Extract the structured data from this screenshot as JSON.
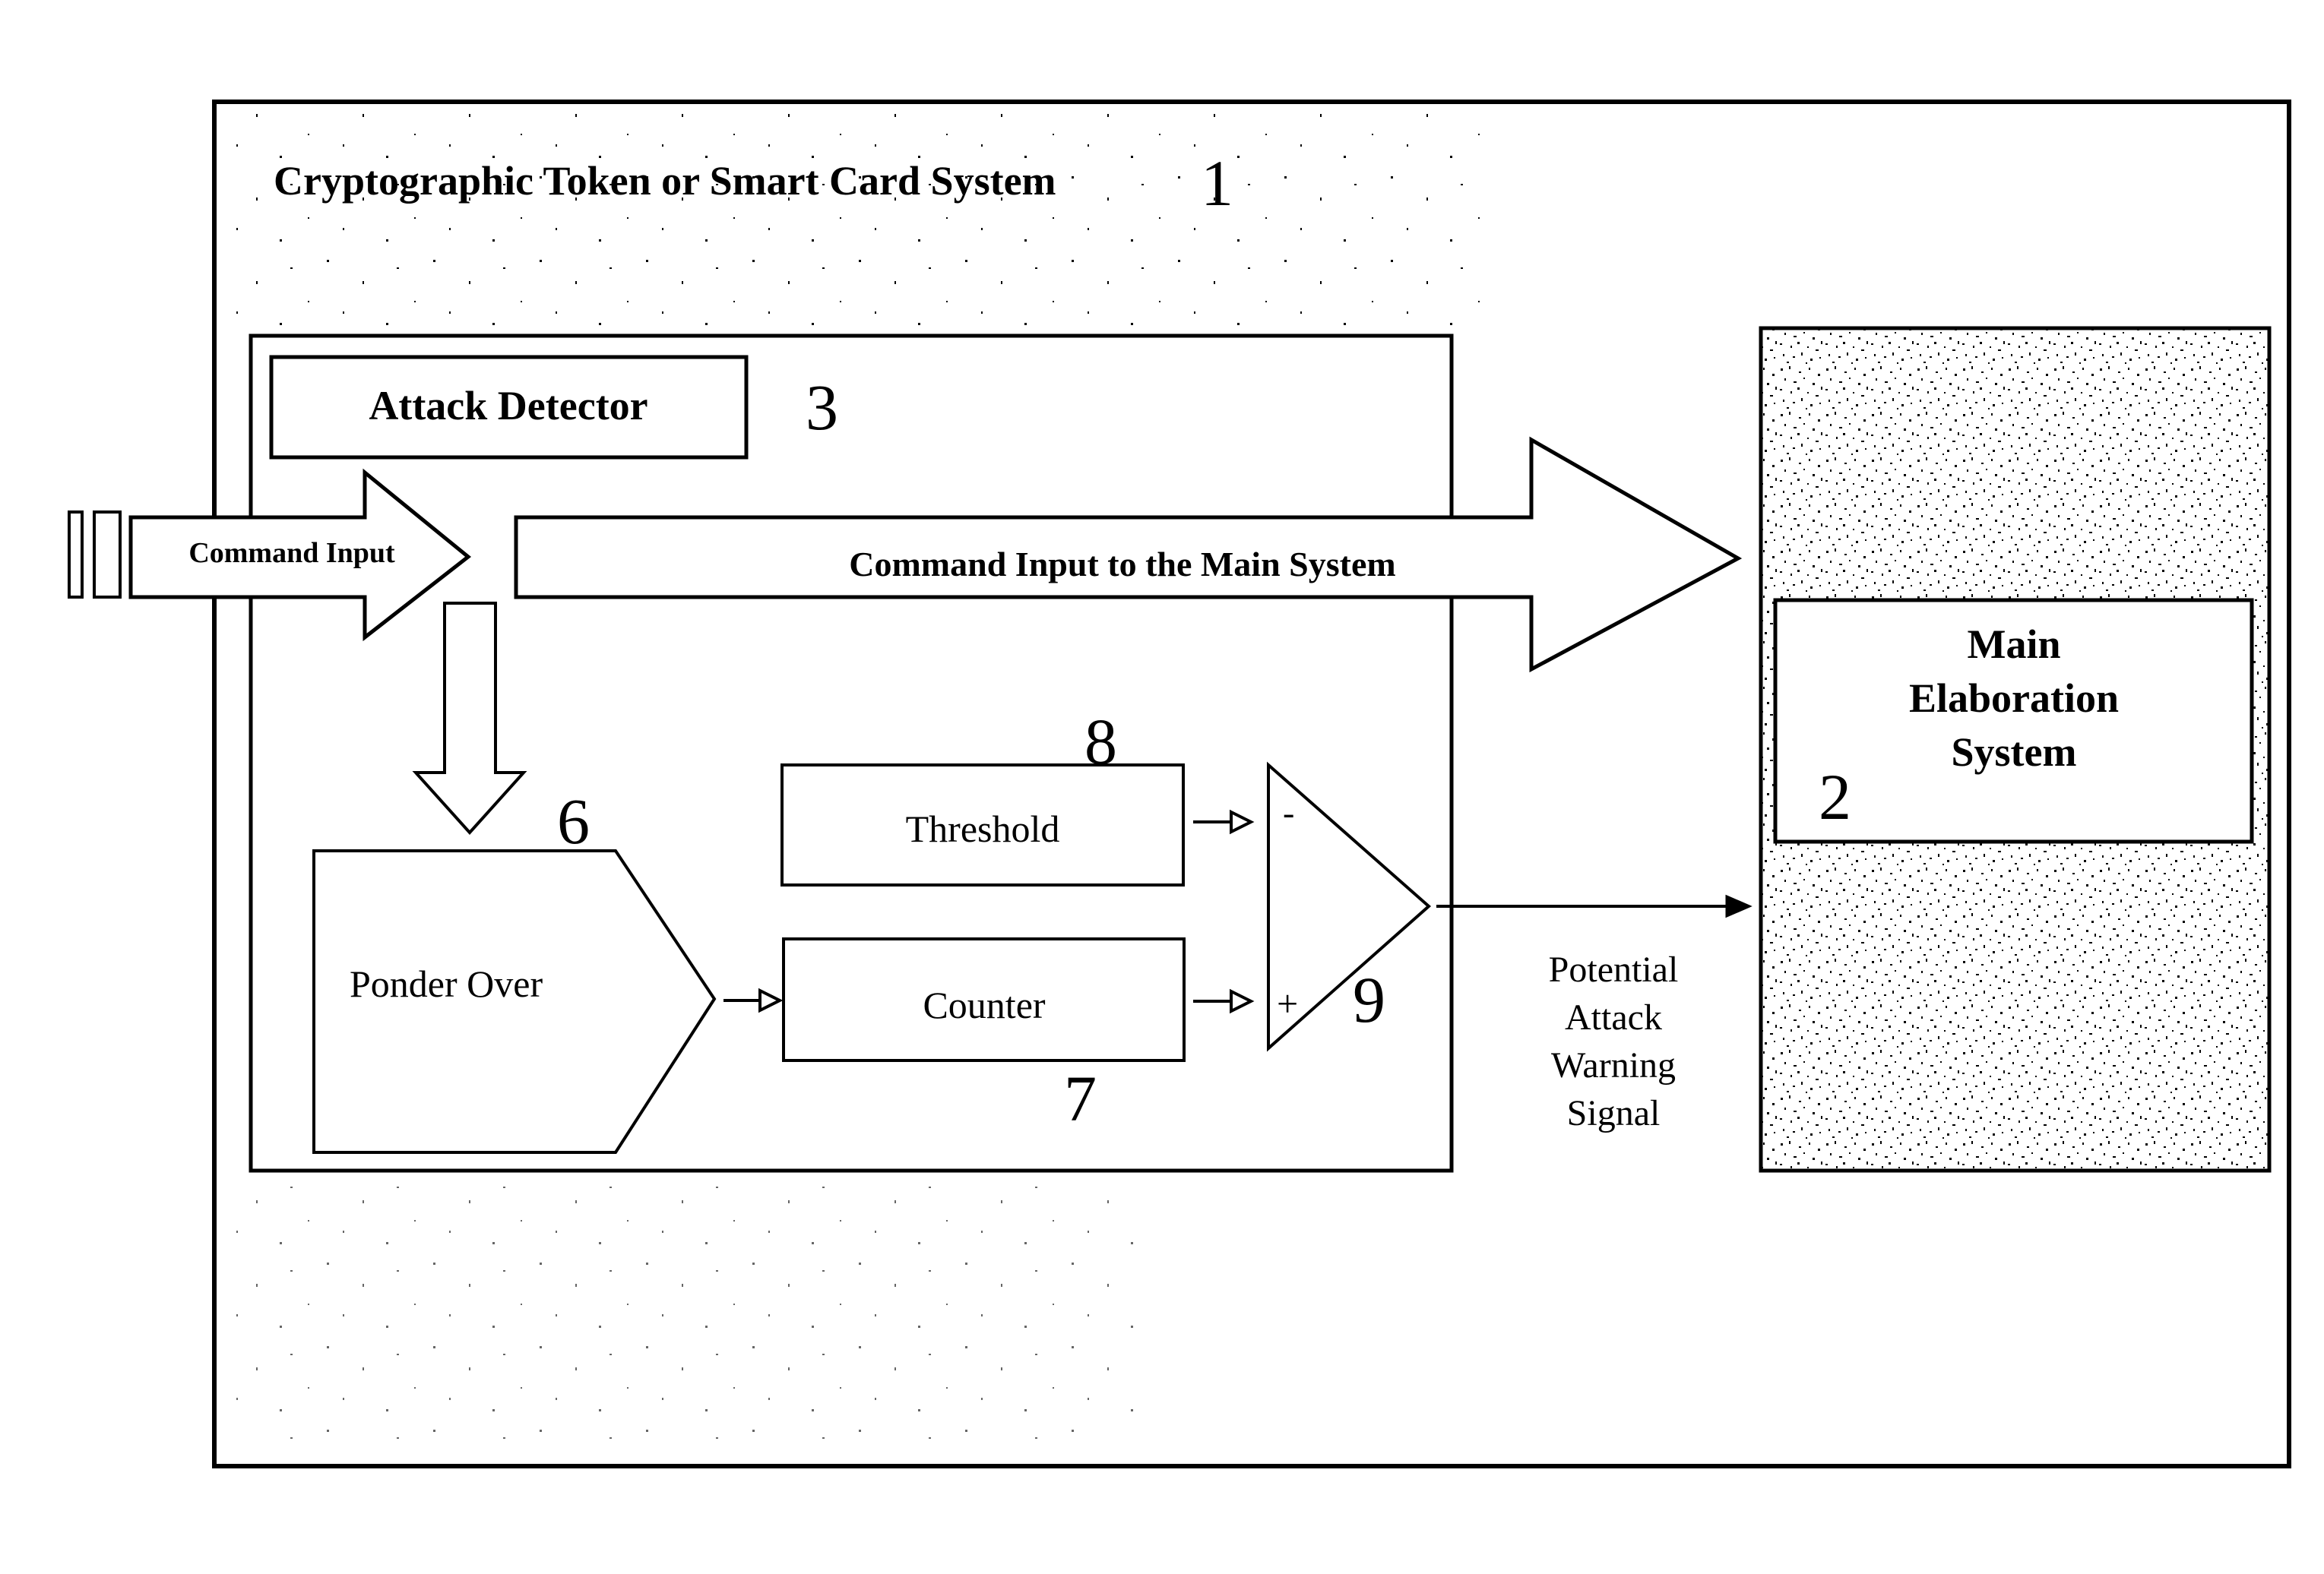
{
  "diagram": {
    "title": "Cryptographic Token or Smart Card System",
    "colors": {
      "ink": "#000000",
      "paper": "#ffffff"
    },
    "blocks": {
      "system": {
        "label": "Cryptographic Token or Smart Card System",
        "ref": "1"
      },
      "main_system": {
        "label_lines": [
          "Main",
          "Elaboration",
          "System"
        ],
        "ref": "2"
      },
      "attack_detector": {
        "label": "Attack Detector",
        "ref": "3"
      },
      "ponder_over": {
        "label": "Ponder Over",
        "ref": "6"
      },
      "counter": {
        "label": "Counter",
        "ref": "7"
      },
      "threshold": {
        "label": "Threshold",
        "ref": "8"
      },
      "comparator": {
        "ref": "9",
        "minus_sign": "-",
        "plus_sign": "+"
      }
    },
    "arrows": {
      "command_input": {
        "label": "Command Input"
      },
      "command_to_main": {
        "label": "Command Input to the Main System"
      },
      "warning_signal": {
        "label_lines": [
          "Potential",
          "Attack",
          "Warning",
          "Signal"
        ]
      }
    }
  }
}
